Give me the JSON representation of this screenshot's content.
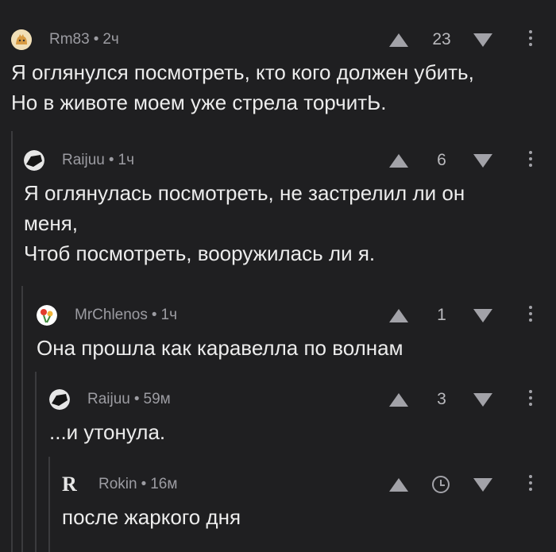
{
  "comments": [
    {
      "author": "Rm83",
      "sep": "•",
      "time": "2ч",
      "score": "23",
      "text": "Я оглянулся посмотреть, кто кого должен убить,\nНо в животе моем уже стрела торчитЬ."
    },
    {
      "author": "Raijuu",
      "sep": "•",
      "time": "1ч",
      "score": "6",
      "text": "Я оглянулась посмотреть, не застрелил ли он\nменя,\nЧтоб посмотреть, вооружилась ли я."
    },
    {
      "author": "MrChlenos",
      "sep": "•",
      "time": "1ч",
      "score": "1",
      "text": "Она прошла как каравелла по волнам"
    },
    {
      "author": "Raijuu",
      "sep": "•",
      "time": "59м",
      "score": "3",
      "text": "...и утонула."
    },
    {
      "author": "Rokin",
      "sep": "•",
      "time": "16м",
      "score": "",
      "avatar_letter": "R",
      "text": "после жаркого дня"
    }
  ],
  "icons": {
    "upvote": "upvote-icon",
    "downvote": "downvote-icon",
    "more": "more-icon",
    "pending": "clock-icon"
  },
  "colors": {
    "background": "#1f1f21",
    "text": "#ececec",
    "meta": "#9c9ca2",
    "thread_line": "#3b3b3e"
  }
}
